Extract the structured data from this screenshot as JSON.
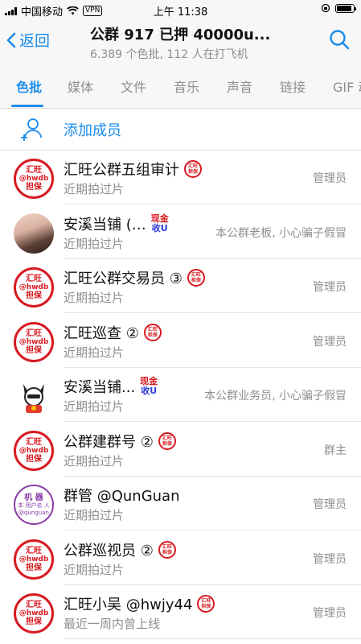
{
  "status_bar": {
    "carrier": "中国移动",
    "vpn": "VPN",
    "time": "上午 11:38",
    "battery_level": 0.9
  },
  "header": {
    "back_label": "返回",
    "title": "公群 917 已押 40000u...",
    "subtitle": "6.389 个色批, 112 人在打飞机"
  },
  "tabs": [
    {
      "label": "色批"
    },
    {
      "label": "媒体"
    },
    {
      "label": "文件"
    },
    {
      "label": "音乐"
    },
    {
      "label": "声音"
    },
    {
      "label": "链接"
    },
    {
      "label": "GIF 动"
    }
  ],
  "add_member": {
    "label": "添加成员"
  },
  "members": [
    {
      "name": "汇旺公群五组审计",
      "status": "近期拍过片",
      "role": "管理员",
      "avatar": "huiwang",
      "badge": "huiwang"
    },
    {
      "name": "安溪当铺 (…",
      "status": "近期拍过片",
      "role": "本公群老板, 小心骗子假冒",
      "avatar": "photo",
      "badge": "cash"
    },
    {
      "name": "汇旺公群交易员 ③",
      "status": "近期拍过片",
      "role": "管理员",
      "avatar": "huiwang",
      "badge": "huiwang"
    },
    {
      "name": "汇旺巡查 ②",
      "status": "近期拍过片",
      "role": "管理员",
      "avatar": "huiwang",
      "badge": "huiwang"
    },
    {
      "name": "安溪当铺...",
      "status": "近期拍过片",
      "role": "本公群业务员, 小心骗子假冒",
      "avatar": "cartoon",
      "badge": "cash"
    },
    {
      "name": "公群建群号 ②",
      "status": "近期拍过片",
      "role": "群主",
      "avatar": "huiwang",
      "badge": "huiwang"
    },
    {
      "name": "群管 @QunGuan",
      "status": "近期拍过片",
      "role": "管理员",
      "avatar": "qunguan",
      "badge": "none"
    },
    {
      "name": "公群巡视员 ②",
      "status": "近期拍过片",
      "role": "管理员",
      "avatar": "huiwang",
      "badge": "huiwang"
    },
    {
      "name": "汇旺小吴 @hwjy44",
      "status": "最近一周内曾上线",
      "role": "管理员",
      "avatar": "huiwang",
      "badge": "huiwang"
    }
  ],
  "avatar_text": {
    "huiwang_line1": "汇旺",
    "huiwang_line2": "@hwdb",
    "huiwang_line3": "担保",
    "badge_line1": "汇旺",
    "badge_line2": "担保",
    "cash_line1": "现金",
    "cash_line2": "收U",
    "qunguan_line1": "机 器",
    "qunguan_line2": "本 用户名 人",
    "qunguan_line3": "@qunguan"
  },
  "colors": {
    "accent": "#1a8cec",
    "secondary_text": "#8e8e93",
    "huiwang_red": "#d71920"
  }
}
